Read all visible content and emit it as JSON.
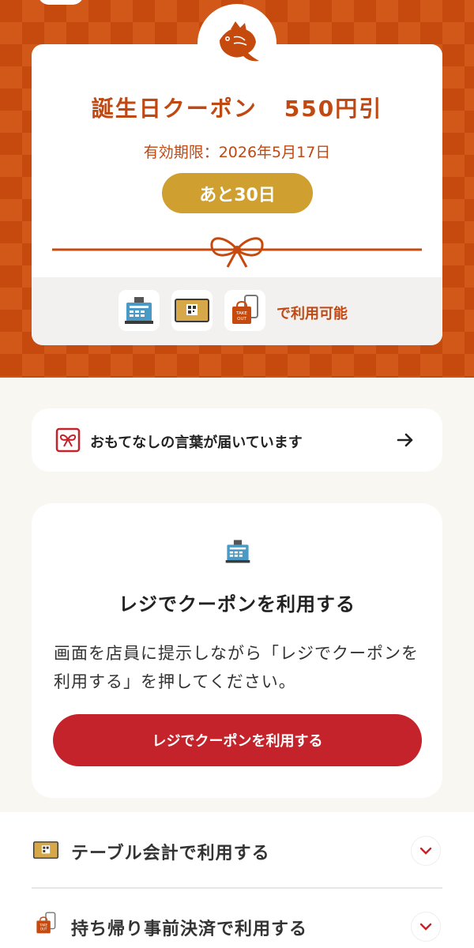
{
  "coupon": {
    "title": "誕生日クーポン",
    "discount": "550円引",
    "expiry": "有効期限：2026年5月17日",
    "days_left": "あと30日",
    "usage_label": "で利用可能"
  },
  "message": {
    "text": "おもてなしの言葉が届いています"
  },
  "register": {
    "title": "レジでクーポンを利用する",
    "description": "画面を店員に提示しながら「レジでクーポンを利用する」を押してください。",
    "button_label": "レジでクーポンを利用する"
  },
  "options": [
    {
      "label": "テーブル会計で利用する",
      "icon": "qr-table-icon"
    },
    {
      "label": "持ち帰り事前決済で利用する",
      "icon": "takeout-bag-icon"
    }
  ],
  "icons": {
    "logo": "sea-bream-fish-icon",
    "register": "cash-register-icon",
    "table": "qr-table-icon",
    "takeout": "takeout-bag-icon",
    "ribbon": "ribbon-bow-icon",
    "gift": "gift-card-icon",
    "arrow": "arrow-right-icon",
    "chevron": "chevron-down-icon"
  },
  "takeout_sticker": [
    "TAKE",
    "OUT"
  ],
  "colors": {
    "brand_orange": "#c64a0d",
    "text_orange": "#c04812",
    "gold": "#cf9f30",
    "button_red": "#c4232b",
    "background": "#f8f7f2"
  }
}
